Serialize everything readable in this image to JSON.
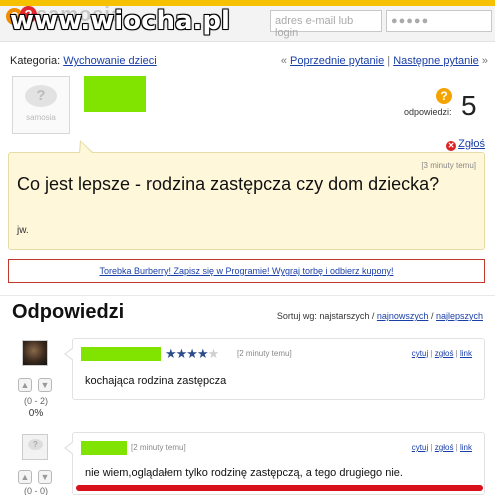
{
  "site": {
    "logo_text": "samosia",
    "watermark": "www.wiocha.pl",
    "colors": {
      "brand_yellow": "#f6c100",
      "username_green": "#80e300",
      "link_blue": "#1a3fa8",
      "alert_red": "#c0392b"
    }
  },
  "login": {
    "email_placeholder": "adres e-mail lub login",
    "password_mask": "●●●●●"
  },
  "category": {
    "label": "Kategoria:",
    "value": "Wychowanie dzieci",
    "prev_link": "Poprzednie pytanie",
    "next_link": "Następne pytanie",
    "prefix": "«",
    "suffix": "»",
    "sep": "|"
  },
  "question": {
    "avatar_caption": "samosia",
    "answers_label": "odpowiedzi:",
    "answers_count": "5",
    "report_label": "Zgłoś",
    "time": "[3 minuty temu]",
    "title": "Co jest lepsze - rodzina zastępcza czy dom dziecka?",
    "body": "jw."
  },
  "promo": {
    "text": "Torebka Burberry! Zapisz się w Programie! Wygraj torbę i odbierz kupony!"
  },
  "answers_section": {
    "title": "Odpowiedzi",
    "sort_label": "Sortuj wg: najstarszych /",
    "sort_newest": "najnowszych",
    "sort_sep": "/",
    "sort_best": "najlepszych"
  },
  "answers": [
    {
      "rating": 3.5,
      "stars_on": "★★★★",
      "stars_off": "★",
      "time": "[2 minuty temu]",
      "action_quote": "cytuj",
      "action_report": "zgłoś",
      "action_link": "link",
      "text": "kochająca rodzina zastępcza",
      "votes": "(0 - 2)",
      "percent": "0%"
    },
    {
      "time": "[2 minuty temu]",
      "action_quote": "cytuj",
      "action_report": "zgłoś",
      "action_link": "link",
      "text": "nie wiem,oglądałem tylko rodzinę zastępczą, a tego drugiego nie.",
      "votes": "(0 - 0)"
    }
  ],
  "icons": [
    "question-mark-icon",
    "report-icon",
    "thumb-up-icon",
    "thumb-down-icon",
    "star-icon"
  ]
}
